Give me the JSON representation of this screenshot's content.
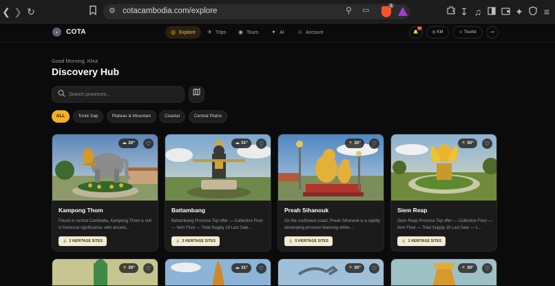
{
  "browser": {
    "url": "cotacambodia.com/explore",
    "shield_count": "1"
  },
  "app": {
    "logo_text": "COTA",
    "logo_mark": "seal",
    "nav": [
      {
        "label": "Explore",
        "icon": "globe-icon",
        "active": true
      },
      {
        "label": "Trips",
        "icon": "plane-icon",
        "active": false
      },
      {
        "label": "Tours",
        "icon": "compass-icon",
        "active": false
      },
      {
        "label": "AI",
        "icon": "sparkle-icon",
        "active": false
      },
      {
        "label": "Account",
        "icon": "user-icon",
        "active": false
      }
    ],
    "notification_count": "9+",
    "language": "KM",
    "role": "Tourist"
  },
  "hero": {
    "greeting": "Good Morning, Khut",
    "title": "Discovery Hub",
    "search_placeholder": "Search provinces..."
  },
  "filters": [
    {
      "label": "ALL",
      "active": true
    },
    {
      "label": "Tonlé Sap",
      "active": false
    },
    {
      "label": "Plateau & Mountain",
      "active": false
    },
    {
      "label": "Coastal",
      "active": false
    },
    {
      "label": "Central Plains",
      "active": false
    }
  ],
  "cards": [
    {
      "title": "Kampong Thom",
      "description": "Found in central Cambodia, Kampong Thom is rich in historical significance, with ancient...",
      "temperature": "30°",
      "weather": "cloud",
      "heritage": "2 HERITAGE SITES"
    },
    {
      "title": "Battambang",
      "description": "Battambang Province Top offer — Collection Floor — Item Floor — Total Supply 18 Last Sale...",
      "temperature": "31°",
      "weather": "cloud",
      "heritage": "3 HERITAGE SITES"
    },
    {
      "title": "Preah Sihanouk",
      "description": "On the southwest coast, Preah Sihanouk is a rapidly developing province featuring white-...",
      "temperature": "30°",
      "weather": "sun",
      "heritage": "5 HERITAGE SITES"
    },
    {
      "title": "Siem Reap",
      "description": "Siem Reap Province Top offer — Collection Floor — Item Floor — Total Supply 18 Last Sale — 1...",
      "temperature": "30°",
      "weather": "sun",
      "heritage": "1 HERITAGE SITES"
    }
  ],
  "cards_row2": [
    {
      "temperature": "30°",
      "weather": "sun"
    },
    {
      "temperature": "31°",
      "weather": "cloud"
    },
    {
      "temperature": "30°",
      "weather": "sun"
    },
    {
      "temperature": "30°",
      "weather": "sun"
    }
  ],
  "colors": {
    "accent": "#f5b21e",
    "background": "#0b0b0b",
    "card": "#1b1b1b"
  }
}
